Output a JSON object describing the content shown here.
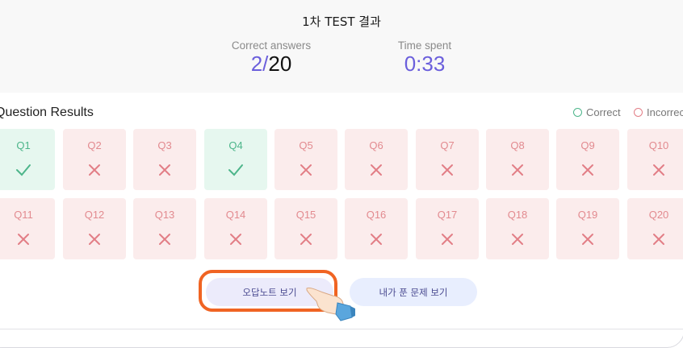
{
  "header": {
    "title": "1차 TEST 결과",
    "correct_label": "Correct answers",
    "correct_count": "2",
    "correct_sep": "/",
    "correct_total": "20",
    "time_label": "Time spent",
    "time_value": "0:33"
  },
  "results": {
    "title": "Question Results",
    "legend_correct": "Correct",
    "legend_incorrect": "Incorrect",
    "questions": [
      {
        "label": "Q1",
        "correct": true
      },
      {
        "label": "Q2",
        "correct": false
      },
      {
        "label": "Q3",
        "correct": false
      },
      {
        "label": "Q4",
        "correct": true
      },
      {
        "label": "Q5",
        "correct": false
      },
      {
        "label": "Q6",
        "correct": false
      },
      {
        "label": "Q7",
        "correct": false
      },
      {
        "label": "Q8",
        "correct": false
      },
      {
        "label": "Q9",
        "correct": false
      },
      {
        "label": "Q10",
        "correct": false
      },
      {
        "label": "Q11",
        "correct": false
      },
      {
        "label": "Q12",
        "correct": false
      },
      {
        "label": "Q13",
        "correct": false
      },
      {
        "label": "Q14",
        "correct": false
      },
      {
        "label": "Q15",
        "correct": false
      },
      {
        "label": "Q16",
        "correct": false
      },
      {
        "label": "Q17",
        "correct": false
      },
      {
        "label": "Q18",
        "correct": false
      },
      {
        "label": "Q19",
        "correct": false
      },
      {
        "label": "Q20",
        "correct": false
      }
    ]
  },
  "buttons": {
    "wrong_note": "오답노트 보기",
    "my_answers": "내가 푼 문제 보기"
  },
  "colors": {
    "accent": "#6b5fdc",
    "correct": "#4cb58a",
    "incorrect": "#e27e86",
    "highlight": "#f06423"
  }
}
